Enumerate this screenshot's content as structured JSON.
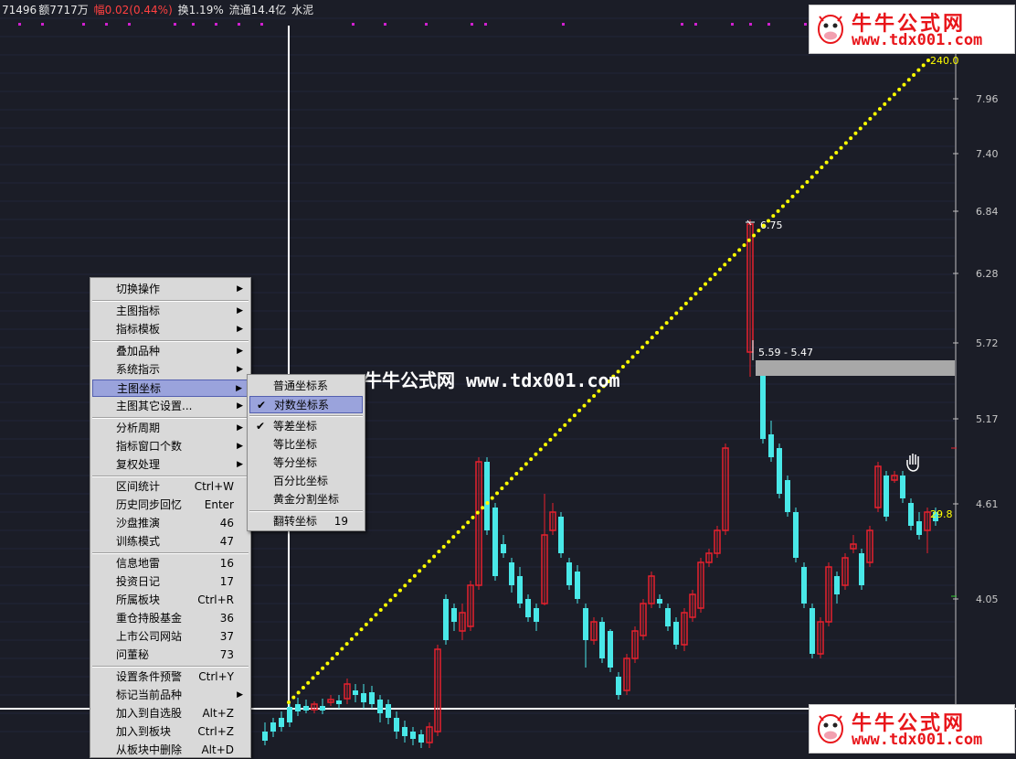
{
  "header": {
    "vol": "71496",
    "amount": "额7717万",
    "change": "幅0.02(0.44%)",
    "turnover": "换1.19%",
    "float": "流通14.4亿",
    "sector": "水泥"
  },
  "price_axis": [
    "7.96",
    "7.40",
    "6.84",
    "6.28",
    "5.72",
    "5.17",
    "4.61",
    "4.05"
  ],
  "labels": {
    "top_right": "240.0",
    "peak": "6.75",
    "zone": "5.59 - 5.47",
    "last": "29.8"
  },
  "watermark": {
    "cn": "牛牛公式网",
    "url": "www.tdx001.com"
  },
  "logo": {
    "name": "牛牛公式网",
    "url": "www.tdx001.com"
  },
  "colors": {
    "bg": "#1b1d27",
    "up": "#e8212e",
    "down": "#49e8e8",
    "trend": "#ffff00",
    "axis": "#ffffff"
  },
  "menu": {
    "items": [
      {
        "label": "切换操作",
        "shortcut": "",
        "arrow": true
      },
      {
        "label": "主图指标",
        "shortcut": "",
        "arrow": true
      },
      {
        "label": "指标模板",
        "shortcut": "",
        "arrow": true
      },
      {
        "label": "叠加品种",
        "shortcut": "",
        "arrow": true
      },
      {
        "label": "系统指示",
        "shortcut": "",
        "arrow": true
      },
      {
        "label": "主图坐标",
        "shortcut": "",
        "arrow": true
      },
      {
        "label": "主图其它设置...",
        "shortcut": "",
        "arrow": true
      },
      {
        "label": "分析周期",
        "shortcut": "",
        "arrow": true
      },
      {
        "label": "指标窗口个数",
        "shortcut": "",
        "arrow": true
      },
      {
        "label": "复权处理",
        "shortcut": "",
        "arrow": true
      },
      {
        "label": "区间统计",
        "shortcut": "Ctrl+W",
        "arrow": false
      },
      {
        "label": "历史同步回忆",
        "shortcut": "Enter",
        "arrow": false
      },
      {
        "label": "沙盘推演",
        "shortcut": "46",
        "arrow": false
      },
      {
        "label": "训练模式",
        "shortcut": "47",
        "arrow": false
      },
      {
        "label": "信息地雷",
        "shortcut": "16",
        "arrow": false
      },
      {
        "label": "投资日记",
        "shortcut": "17",
        "arrow": false
      },
      {
        "label": "所属板块",
        "shortcut": "Ctrl+R",
        "arrow": false
      },
      {
        "label": "重仓持股基金",
        "shortcut": "36",
        "arrow": false
      },
      {
        "label": "上市公司网站",
        "shortcut": "37",
        "arrow": false
      },
      {
        "label": "问董秘",
        "shortcut": "73",
        "arrow": false
      },
      {
        "label": "设置条件预警",
        "shortcut": "Ctrl+Y",
        "arrow": false
      },
      {
        "label": "标记当前品种",
        "shortcut": "",
        "arrow": true
      },
      {
        "label": "加入到自选股",
        "shortcut": "Alt+Z",
        "arrow": false
      },
      {
        "label": "加入到板块",
        "shortcut": "Ctrl+Z",
        "arrow": false
      },
      {
        "label": "从板块中删除",
        "shortcut": "Alt+D",
        "arrow": false
      }
    ]
  },
  "submenu": {
    "items": [
      {
        "label": "普通坐标系",
        "shortcut": "",
        "checked": false
      },
      {
        "label": "对数坐标系",
        "shortcut": "",
        "checked": true
      },
      {
        "label": "等差坐标",
        "shortcut": "",
        "checked": true
      },
      {
        "label": "等比坐标",
        "shortcut": "",
        "checked": false
      },
      {
        "label": "等分坐标",
        "shortcut": "",
        "checked": false
      },
      {
        "label": "百分比坐标",
        "shortcut": "",
        "checked": false
      },
      {
        "label": "黄金分割坐标",
        "shortcut": "",
        "checked": false
      },
      {
        "label": "翻转坐标",
        "shortcut": "19",
        "checked": false
      }
    ]
  }
}
